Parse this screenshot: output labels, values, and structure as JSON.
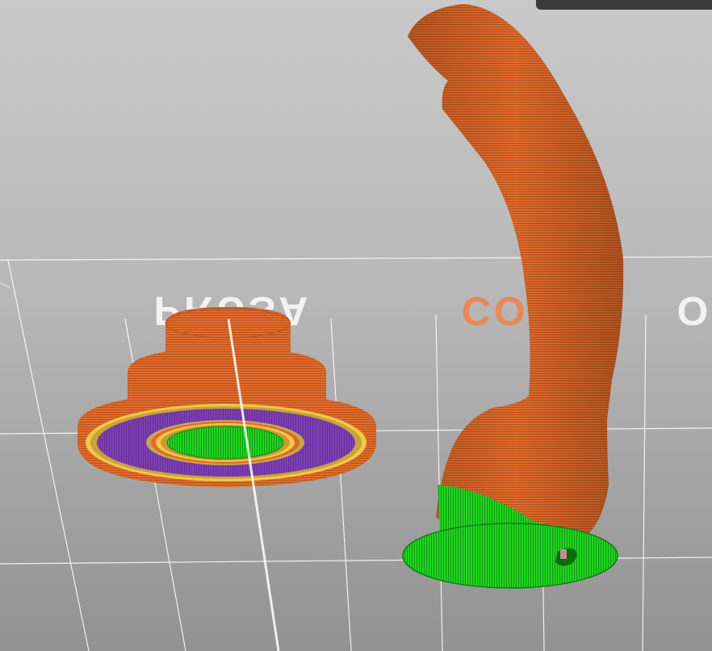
{
  "viewport": {
    "bed_logo": {
      "brand": "PRUSA",
      "model": "CORE",
      "trailing": "O",
      "brand_color": "#f2f2f2",
      "model_color": "#e8895a"
    },
    "colors": {
      "background_top": "#c6c6c6",
      "background_bottom": "#959595",
      "grid": "#ffffff",
      "perimeter": "#e06a2b",
      "perimeter_dark": "#b9541e",
      "external_perimeter": "#f0c84a",
      "solid_infill": "#7c3fb0",
      "top_infill": "#1ecb1e",
      "top_infill_dark": "#109a10"
    }
  }
}
